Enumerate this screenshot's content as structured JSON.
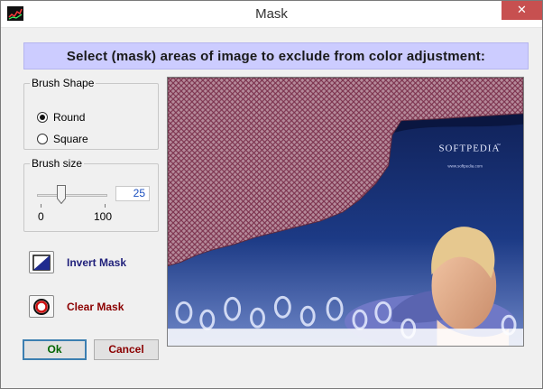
{
  "window": {
    "title": "Mask",
    "close_glyph": "✕",
    "app_icon": "mask-app-icon"
  },
  "banner": {
    "text": "Select (mask) areas of image to exclude from color adjustment:",
    "watermark": "SOFTPEDIA"
  },
  "brush_shape": {
    "legend": "Brush Shape",
    "options": [
      {
        "label": "Round",
        "selected": true
      },
      {
        "label": "Square",
        "selected": false
      }
    ]
  },
  "brush_size": {
    "legend": "Brush size",
    "value": "25",
    "min_label": "0",
    "max_label": "100",
    "level": 0.25
  },
  "actions": {
    "invert_mask": "Invert Mask",
    "clear_mask": "Clear Mask"
  },
  "buttons": {
    "ok": "Ok",
    "cancel": "Cancel"
  },
  "image": {
    "brand": "SOFTPEDIA",
    "trademark": "™",
    "url": "www.softpedia.com",
    "mask_color": "#9a5a72",
    "background_color": "#14265e"
  }
}
